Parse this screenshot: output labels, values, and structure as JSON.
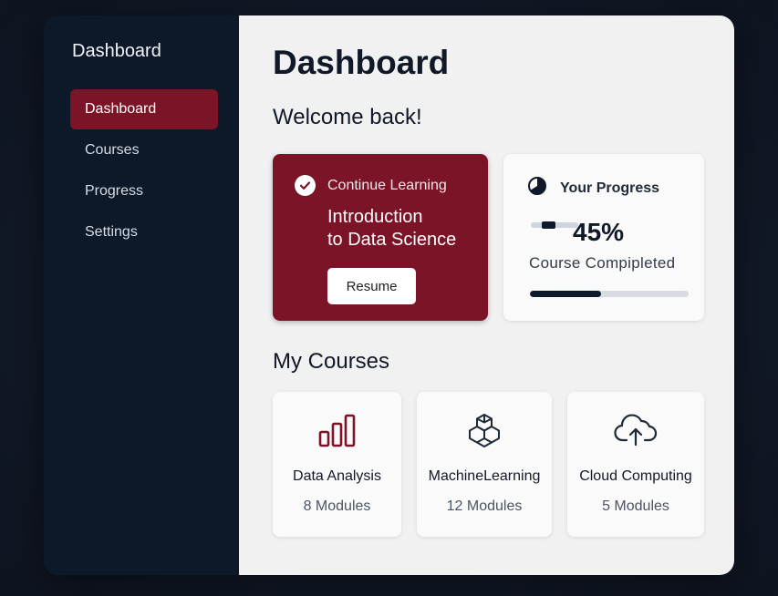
{
  "sidebar": {
    "title": "Dashboard",
    "items": [
      {
        "label": "Dashboard",
        "active": true
      },
      {
        "label": "Courses",
        "active": false
      },
      {
        "label": "Progress",
        "active": false
      },
      {
        "label": "Settings",
        "active": false
      }
    ]
  },
  "main": {
    "title": "Dashboard",
    "welcome": "Welcome back!",
    "continue_card": {
      "label": "Continue Learning",
      "course_line1": "Introduction",
      "course_line2": "to Data Science",
      "button": "Resume",
      "icon": "check-circle-icon"
    },
    "progress_card": {
      "label": "Your Progress",
      "percent_text": "45%",
      "percent_value": 45,
      "subtitle": "Course Compipleted",
      "icon": "pie-icon"
    },
    "courses_title": "My Courses",
    "courses": [
      {
        "name": "Data Analysis",
        "modules": "8 Modules",
        "icon": "bar-chart-icon"
      },
      {
        "name": "MachineLearning",
        "modules": "12 Modules",
        "icon": "cubes-icon"
      },
      {
        "name": "Cloud Computing",
        "modules": "5 Modules",
        "icon": "cloud-upload-icon"
      }
    ]
  },
  "colors": {
    "accent": "#7b1426",
    "sidebar_bg": "#0d1829",
    "main_bg": "#f1f1f2"
  }
}
